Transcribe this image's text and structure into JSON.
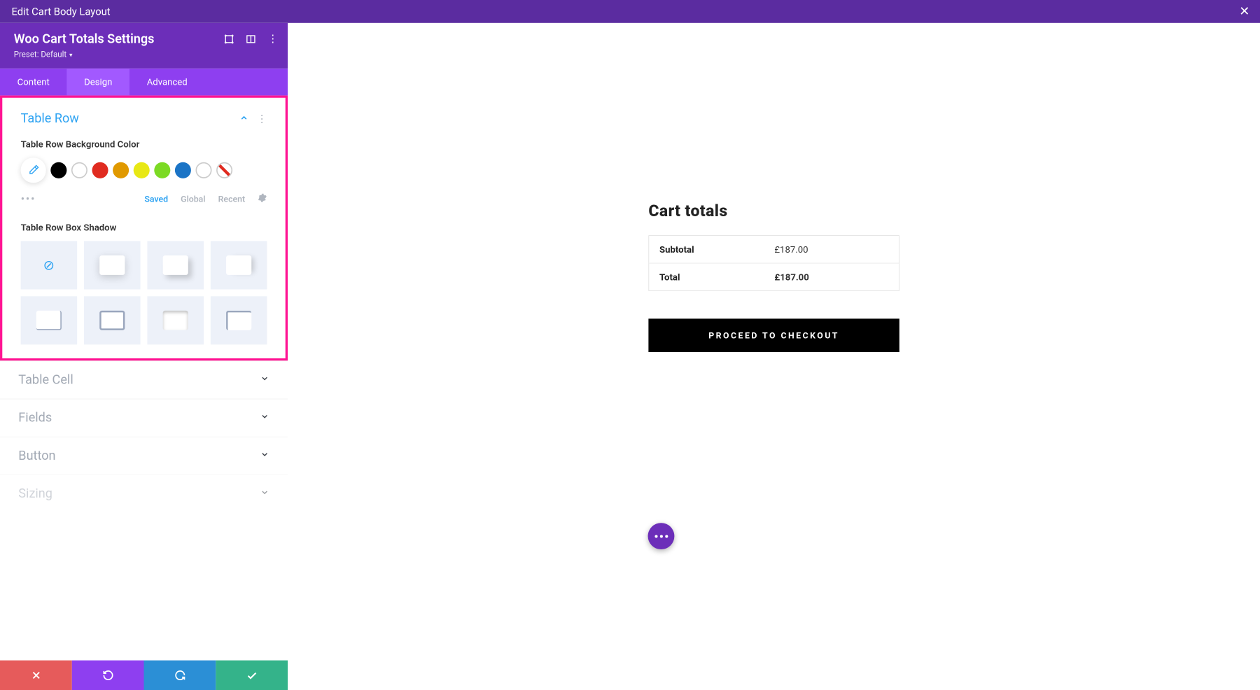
{
  "topbar": {
    "title": "Edit Cart Body Layout"
  },
  "header": {
    "title": "Woo Cart Totals Settings",
    "preset_prefix": "Preset: ",
    "preset_value": "Default"
  },
  "tabs": {
    "content": "Content",
    "design": "Design",
    "advanced": "Advanced"
  },
  "section": {
    "title": "Table Row",
    "bg_label": "Table Row Background Color",
    "shadow_label": "Table Row Box Shadow"
  },
  "colors": {
    "black": "#000000",
    "white": "#ffffff",
    "red": "#e02b20",
    "orange": "#e09900",
    "yellow": "#e8e815",
    "green": "#7cda24",
    "blue": "#1b74c6"
  },
  "palette_tabs": {
    "saved": "Saved",
    "global": "Global",
    "recent": "Recent"
  },
  "collapsed": {
    "table_cell": "Table Cell",
    "fields": "Fields",
    "button": "Button",
    "sizing": "Sizing"
  },
  "cart": {
    "heading": "Cart totals",
    "subtotal_label": "Subtotal",
    "subtotal_value": "£187.00",
    "total_label": "Total",
    "total_value": "£187.00",
    "checkout": "PROCEED TO CHECKOUT"
  }
}
